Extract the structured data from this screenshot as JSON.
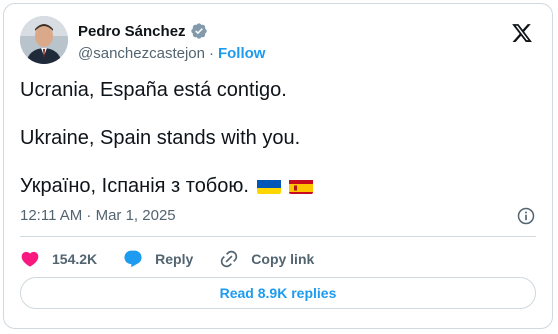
{
  "author": {
    "name": "Pedro Sánchez",
    "handle": "@sanchezcastejon",
    "separator": "·",
    "follow_label": "Follow",
    "verified_icon": "verified-badge-icon",
    "avatar": "avatar"
  },
  "tweet": {
    "line1": "Ucrania, España está contigo.",
    "line2": "Ukraine, Spain stands with you.",
    "line3": "Україно, Іспанія з тобою.",
    "flags": [
      "ukraine-flag-icon",
      "spain-flag-icon"
    ],
    "timestamp": "12:11 AM · Mar 1, 2025"
  },
  "actions": {
    "like_count": "154.2K",
    "reply_label": "Reply",
    "copy_link_label": "Copy link"
  },
  "footer": {
    "read_replies_label": "Read 8.9K replies"
  },
  "colors": {
    "accent": "#1d9bf0",
    "like": "#f91880",
    "text": "#0f1419",
    "muted": "#536471",
    "border": "#cfd9de"
  }
}
